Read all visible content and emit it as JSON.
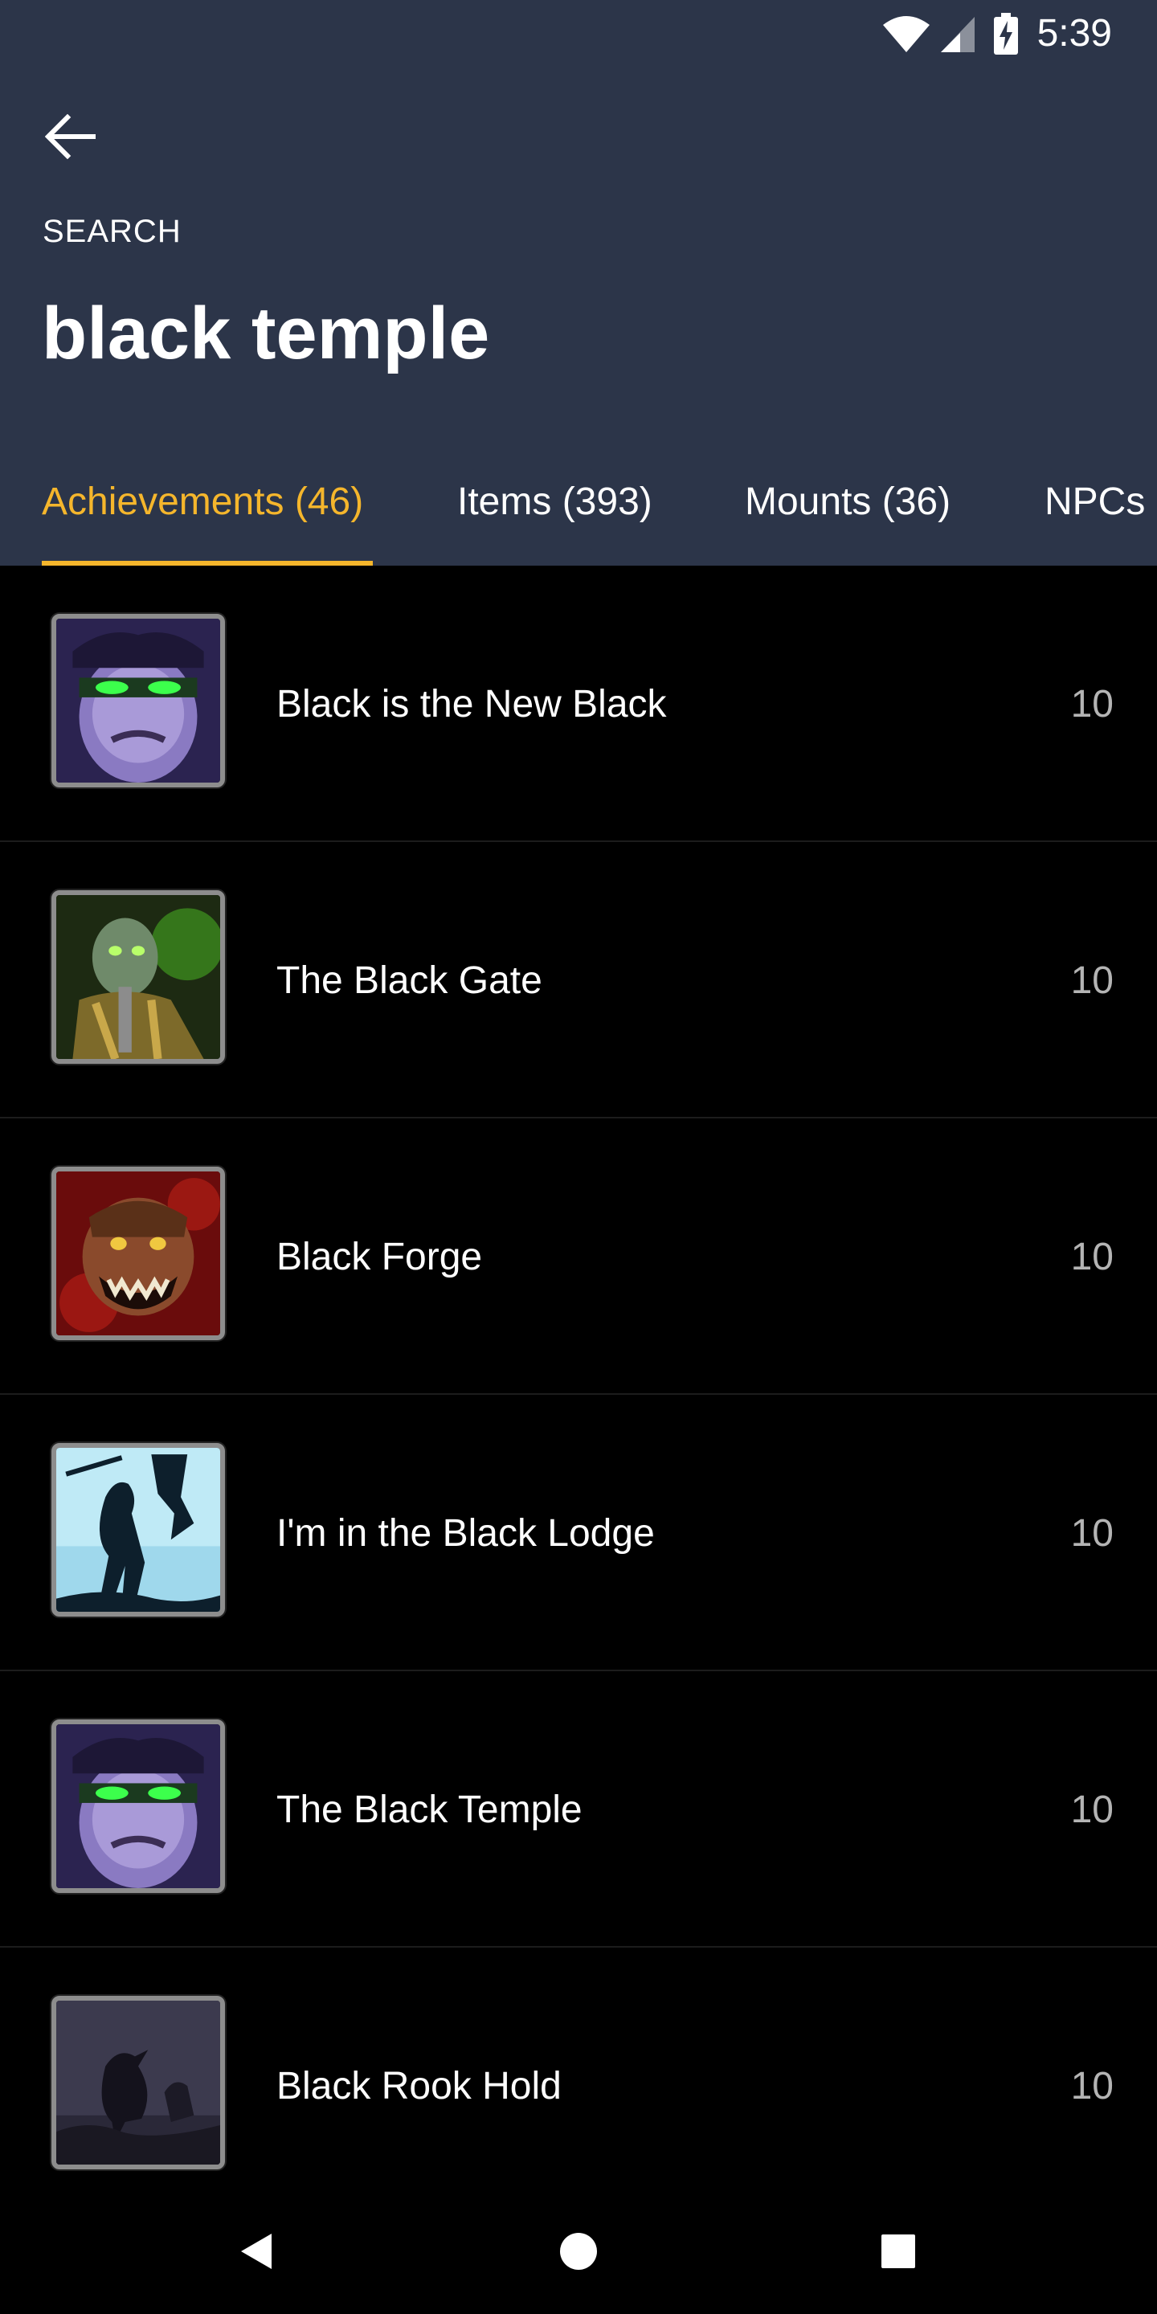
{
  "status_bar": {
    "time": "5:39",
    "icons": [
      "wifi-icon",
      "cellular-signal-icon",
      "battery-charging-icon"
    ]
  },
  "header": {
    "back_icon": "arrow-left-icon",
    "overline": "SEARCH",
    "title": "black temple"
  },
  "tabs": [
    {
      "label": "Achievements (46)",
      "active": true
    },
    {
      "label": "Items (393)",
      "active": false
    },
    {
      "label": "Mounts (36)",
      "active": false
    },
    {
      "label": "NPCs (",
      "active": false
    }
  ],
  "results": [
    {
      "name": "Black is the New Black",
      "points": "10",
      "icon": "demon-hunter-face-icon"
    },
    {
      "name": "The Black Gate",
      "points": "10",
      "icon": "orc-warlock-icon"
    },
    {
      "name": "Black Forge",
      "points": "10",
      "icon": "ogre-face-icon"
    },
    {
      "name": "I'm in the Black Lodge",
      "points": "10",
      "icon": "silhouette-banner-icon"
    },
    {
      "name": "The Black Temple",
      "points": "10",
      "icon": "demon-hunter-face-icon"
    },
    {
      "name": "Black Rook Hold",
      "points": "10",
      "icon": "raven-icon"
    }
  ],
  "nav_bar": {
    "back": "nav-back-icon",
    "home": "nav-home-icon",
    "recents": "nav-recents-icon"
  },
  "colors": {
    "header_bg": "#2c3549",
    "accent": "#f5b62c",
    "list_bg": "#000000",
    "points_text": "#b4b4b4"
  }
}
